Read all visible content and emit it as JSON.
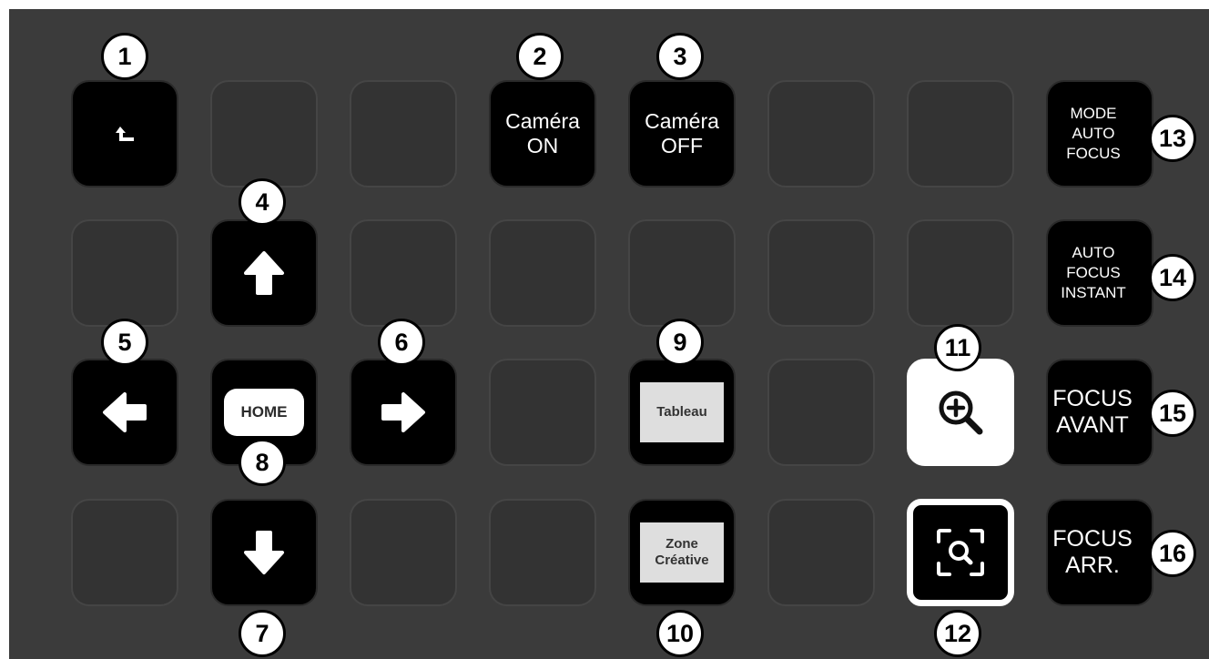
{
  "keys": {
    "back": {
      "icon": "return-arrow-icon"
    },
    "camera_on": {
      "label_line1": "Caméra",
      "label_line2": "ON"
    },
    "camera_off": {
      "label_line1": "Caméra",
      "label_line2": "OFF"
    },
    "mode_auto_focus": {
      "label_line1": "MODE",
      "label_line2": "AUTO",
      "label_line3": "FOCUS"
    },
    "up": {
      "icon": "arrow-up-icon"
    },
    "auto_focus_instant": {
      "label_line1": "AUTO",
      "label_line2": "FOCUS",
      "label_line3": "INSTANT"
    },
    "left": {
      "icon": "arrow-left-icon"
    },
    "home": {
      "label": "HOME"
    },
    "right": {
      "icon": "arrow-right-icon"
    },
    "tableau": {
      "label": "Tableau"
    },
    "zoom_in": {
      "icon": "zoom-in-icon"
    },
    "focus_avant": {
      "label_line1": "FOCUS",
      "label_line2": "AVANT"
    },
    "down": {
      "icon": "arrow-down-icon"
    },
    "zone_creative": {
      "label_line1": "Zone",
      "label_line2": "Créative"
    },
    "focus_frame": {
      "icon": "focus-frame-icon"
    },
    "focus_arr": {
      "label_line1": "FOCUS",
      "label_line2": "ARR."
    }
  },
  "badges": [
    "1",
    "2",
    "3",
    "4",
    "5",
    "6",
    "7",
    "8",
    "9",
    "10",
    "11",
    "12",
    "13",
    "14",
    "15",
    "16"
  ],
  "colors": {
    "background": "#3b3b3b",
    "key_empty": "#333333",
    "key_black": "#000000",
    "badge": "#ffffff"
  }
}
